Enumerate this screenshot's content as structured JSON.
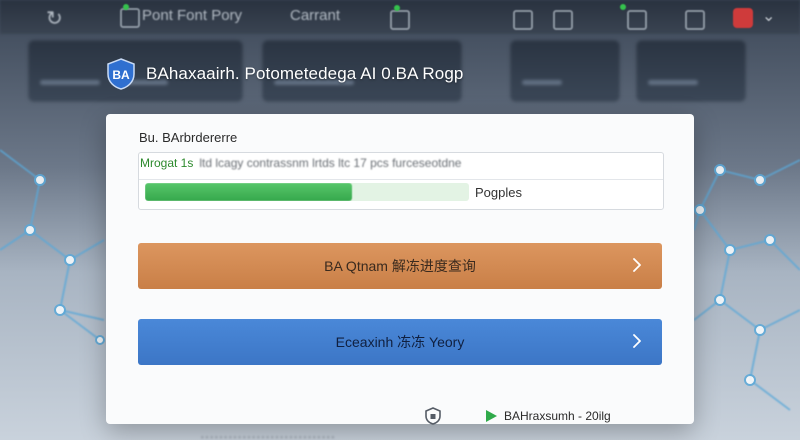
{
  "background": {
    "top_texts": [
      "Pont Font Pory",
      "Carrant"
    ]
  },
  "header": {
    "logo_text": "BA",
    "title": "BAhaxaairh. Potometedega AI  0.BA Rogp"
  },
  "card": {
    "subtitle": "Bu. BArbrdererre",
    "info_label": "Mrogat 1s",
    "info_blurred": "ltd lcagy contrassnm lrtds ltc 17 pcs furceseotdne",
    "progress_label": "Pogples",
    "progress_value": 0.64
  },
  "actions": {
    "primary_label": "BA Qtnam 解冻进度查询",
    "secondary_label": "Eceaxinh 冻冻 Yeory"
  },
  "footer": {
    "text": "BAHraxsumh - 20ilg"
  },
  "colors": {
    "primary": "#d78f57",
    "secondary": "#4480d0",
    "progress": "#3fb454",
    "logo": "#2f6fd0"
  },
  "icons": {
    "logo": "shield-icon",
    "chevron": "chevron-right-icon",
    "footer_left": "shield-outline-icon",
    "footer_right": "play-icon"
  }
}
